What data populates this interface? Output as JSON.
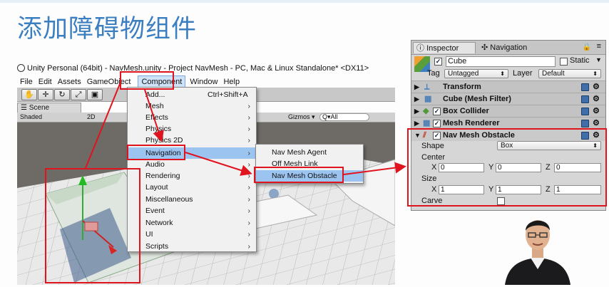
{
  "slide_title": "添加障碍物组件",
  "window_title": "Unity Personal (64bit) - NavMesh.unity - Project NavMesh - PC, Mac & Linux Standalone* <DX11>",
  "menubar": [
    "File",
    "Edit",
    "Assets",
    "GameObject",
    "Component",
    "Window",
    "Help"
  ],
  "scene": {
    "tab": "Scene",
    "shading": "Shaded",
    "mode": "2D",
    "gizmos": "Gizmos ▾",
    "search_placeholder": "Q▾All"
  },
  "component_menu": {
    "items": [
      {
        "label": "Add...",
        "shortcut": "Ctrl+Shift+A",
        "sub": false
      },
      {
        "label": "Mesh",
        "shortcut": "",
        "sub": true
      },
      {
        "label": "Effects",
        "shortcut": "",
        "sub": true
      },
      {
        "label": "Physics",
        "shortcut": "",
        "sub": true
      },
      {
        "label": "Physics 2D",
        "shortcut": "",
        "sub": true
      },
      {
        "label": "Navigation",
        "shortcut": "",
        "sub": true
      },
      {
        "label": "Audio",
        "shortcut": "",
        "sub": true
      },
      {
        "label": "Rendering",
        "shortcut": "",
        "sub": true
      },
      {
        "label": "Layout",
        "shortcut": "",
        "sub": true
      },
      {
        "label": "Miscellaneous",
        "shortcut": "",
        "sub": true
      },
      {
        "label": "Event",
        "shortcut": "",
        "sub": true
      },
      {
        "label": "Network",
        "shortcut": "",
        "sub": true
      },
      {
        "label": "UI",
        "shortcut": "",
        "sub": true
      },
      {
        "label": "Scripts",
        "shortcut": "",
        "sub": true
      }
    ],
    "highlighted": "Navigation"
  },
  "navigation_submenu": [
    "Nav Mesh Agent",
    "Off Mesh Link",
    "Nav Mesh Obstacle"
  ],
  "inspector": {
    "tabs": [
      "Inspector",
      "Navigation"
    ],
    "object_name": "Cube",
    "static_label": "Static",
    "tag_label": "Tag",
    "tag_value": "Untagged",
    "layer_label": "Layer",
    "layer_value": "Default",
    "components": [
      "Transform",
      "Cube (Mesh Filter)",
      "Box Collider",
      "Mesh Renderer",
      "Nav Mesh Obstacle"
    ],
    "obstacle": {
      "shape_label": "Shape",
      "shape_value": "Box",
      "center_label": "Center",
      "center": {
        "x": "0",
        "y": "0",
        "z": "0"
      },
      "size_label": "Size",
      "size": {
        "x": "1",
        "y": "1",
        "z": "1"
      },
      "carve_label": "Carve"
    }
  },
  "colors": {
    "highlight": "#e0141e",
    "menu_hover": "#9cc4f0",
    "title": "#3c7fc1"
  }
}
